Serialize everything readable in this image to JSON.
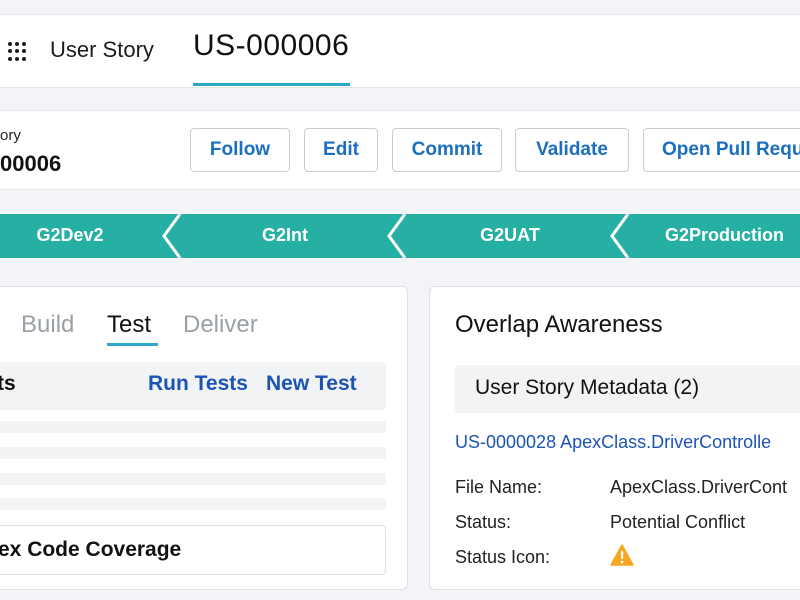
{
  "topbar": {
    "app_title": "User Story",
    "record_tab": "US-000006"
  },
  "header": {
    "object_type": "ory",
    "record_name": "00006",
    "buttons": {
      "follow": "Follow",
      "edit": "Edit",
      "commit": "Commit",
      "validate": "Validate",
      "open_pull_request": "Open Pull Requ"
    }
  },
  "pipeline": {
    "color": "#26b0a3",
    "stages": [
      "G2Dev2",
      "G2Int",
      "G2UAT",
      "G2Production"
    ]
  },
  "left_panel": {
    "tabs": {
      "build": "Build",
      "test": "Test",
      "deliver": "Deliver"
    },
    "active_tab": "Test",
    "tests_title": "ts",
    "run_tests": "Run Tests",
    "new_test": "New Test",
    "coverage_title": "ex Code Coverage"
  },
  "right_panel": {
    "title": "Overlap Awareness",
    "metadata_title": "User Story Metadata (2)",
    "record_link": "US-0000028 ApexClass.DriverControlle",
    "fields": {
      "file_name_label": "File Name:",
      "file_name_value": "ApexClass.DriverCont",
      "status_label": "Status:",
      "status_value": "Potential Conflict",
      "status_icon_label": "Status Icon:",
      "status_icon": "warning-icon"
    },
    "warning_color": "#f5a623"
  }
}
